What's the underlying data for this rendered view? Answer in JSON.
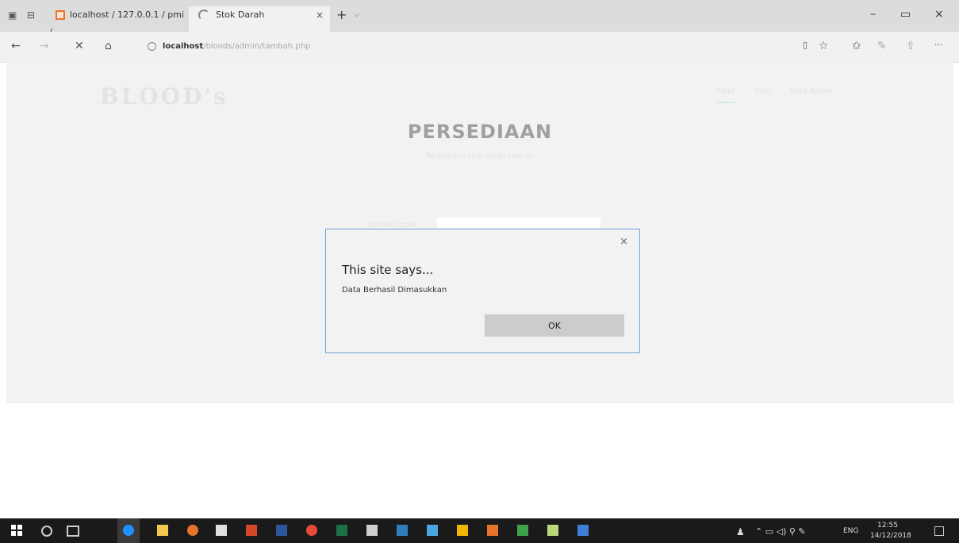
{
  "browser": {
    "tabs": [
      {
        "label": "localhost / 127.0.0.1 / pmi /"
      },
      {
        "label": "Stok Darah"
      }
    ],
    "tab_close": "×",
    "new_tab": "+",
    "tab_dropdown": "⌵",
    "window_controls": {
      "minimize": "–",
      "maximize": "▭",
      "close": "×"
    },
    "nav_icons": {
      "back": "←",
      "forward": "→",
      "stop": "✕",
      "home": "⌂"
    },
    "address": {
      "host": "localhost",
      "path": "/bloods/admin/tambah.php"
    },
    "toolbar_icons": [
      "reading-view-icon",
      "favorite-star-icon",
      "favorites-list-icon",
      "pen-icon",
      "share-icon",
      "more-icon"
    ],
    "toolbar_glyphs": [
      "▯",
      "☆",
      "✩",
      "✎",
      "⇪",
      "···"
    ]
  },
  "site": {
    "logo": "BLOOD's",
    "nav": [
      "Input",
      "Stok",
      "Data Admin"
    ],
    "title": "PERSEDIAAN",
    "subtitle": "Persediaan stok darah saat ini",
    "form_label": "Jumlah Darah"
  },
  "dialog": {
    "close": "×",
    "title": "This site says...",
    "message": "Data Berhasil Dimasukkan",
    "ok": "OK"
  },
  "taskbar": {
    "icons": [
      "windows-start-icon",
      "search-icon",
      "task-view-icon",
      "edge-icon",
      "file-explorer-icon",
      "firefox-icon",
      "store-icon",
      "powerpoint-icon",
      "word-icon",
      "chrome-icon",
      "excel-icon",
      "app-icon",
      "app-icon",
      "app-icon",
      "app-icon",
      "app-icon",
      "app-icon",
      "app-icon",
      "app-icon"
    ],
    "tray": {
      "language": "ENG",
      "time": "12:55",
      "date": "14/12/2018"
    }
  },
  "colors": {
    "accent_border": "#6fa4d6",
    "taskbar": "#1a1a1a",
    "tab_favicon": "#e8742a"
  }
}
